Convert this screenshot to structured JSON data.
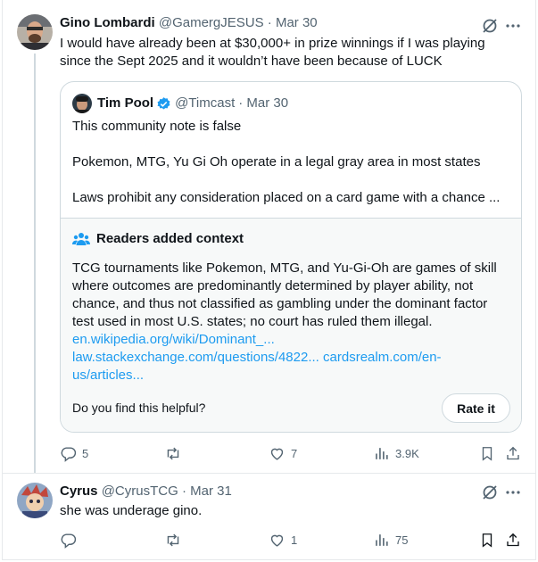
{
  "post1": {
    "author_name": "Gino Lombardi",
    "handle": "@GamergJESUS",
    "time": "· Mar 30",
    "text_line1": "I would have already been at $30,000+ in prize winnings if I was playing",
    "text_line2": "since the Sept 2025 and it wouldn’t have been because of LUCK",
    "quote": {
      "author_name": "Tim Pool",
      "handle": "@Timcast",
      "time": "· Mar 30",
      "line1": "This community note is false",
      "line2": "Pokemon, MTG, Yu Gi Oh operate in a legal gray area in most states",
      "line3": "Laws prohibit any consideration placed on a card game with a chance ..."
    },
    "note": {
      "title": "Readers added context",
      "body_line1": "TCG tournaments like Pokemon, MTG, and Yu-Gi-Oh are games of skill",
      "body_line2": "where outcomes are predominantly determined by player ability, not",
      "body_line3": "chance, and thus not classified as gambling under the dominant factor",
      "body_line4": "test used in most U.S. states; no court has ruled them illegal.",
      "link1": "en.wikipedia.org/wiki/Dominant_...",
      "link2": "law.stackexchange.com/questions/4822...",
      "link3a": "cardsrealm.com/en-",
      "link3b": "us/articles...",
      "helpful_prompt": "Do you find this helpful?",
      "rate_button": "Rate it"
    },
    "actions": {
      "replies": "5",
      "reposts": "",
      "likes": "7",
      "views": "3.9K"
    }
  },
  "post2": {
    "author_name": "Cyrus",
    "handle": "@CyrusTCG",
    "time": "· Mar 31",
    "text": "she was underage gino.",
    "actions": {
      "replies": "",
      "reposts": "",
      "likes": "1",
      "views": "75"
    }
  },
  "colors": {
    "accent": "#1d9bf0",
    "muted": "#536471",
    "verified": "#1d9bf0"
  }
}
